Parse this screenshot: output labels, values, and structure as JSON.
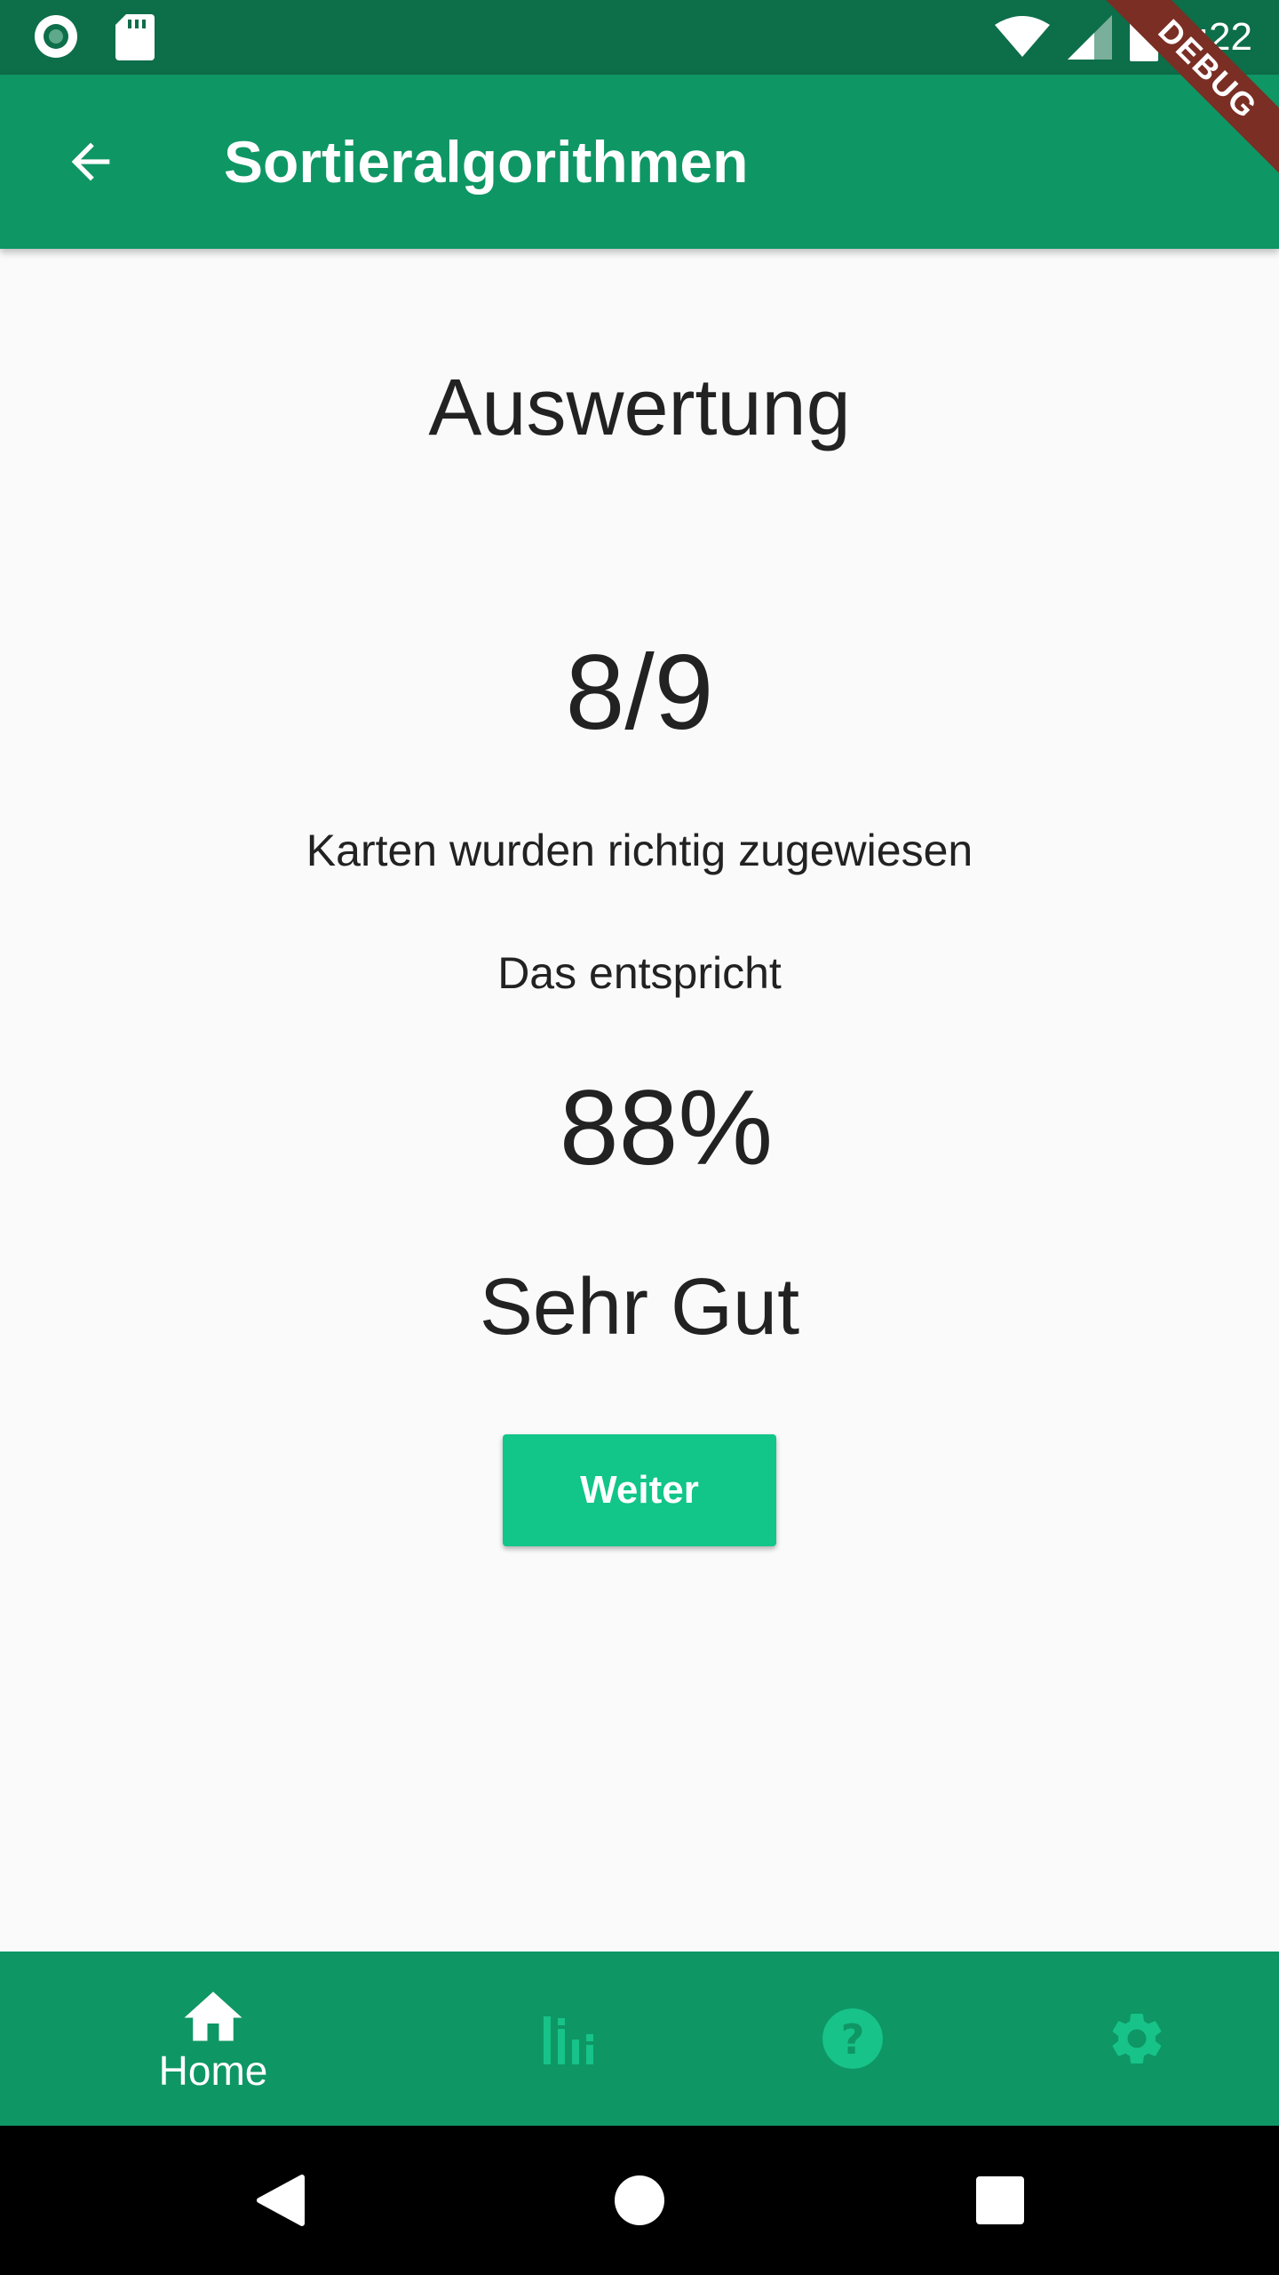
{
  "status_bar": {
    "time": "4:22",
    "icons": [
      "record-icon",
      "sd-card-icon",
      "wifi-icon",
      "signal-icon",
      "battery-icon"
    ]
  },
  "debug_banner": "DEBUG",
  "app_bar": {
    "title": "Sortieralgorithmen",
    "back_icon": "arrow-back-icon"
  },
  "result": {
    "heading": "Auswertung",
    "score": "8/9",
    "score_caption": "Karten wurden richtig zugewiesen",
    "equals_caption": "Das entspricht",
    "percent": "88%",
    "grade": "Sehr Gut",
    "next_button": "Weiter"
  },
  "bottom_nav": {
    "items": [
      {
        "label": "Home",
        "icon": "home-icon",
        "active": true
      },
      {
        "label": "",
        "icon": "bar-chart-icon",
        "active": false
      },
      {
        "label": "",
        "icon": "help-icon",
        "active": false
      },
      {
        "label": "",
        "icon": "settings-icon",
        "active": false
      }
    ]
  },
  "colors": {
    "status_bar": "#0d6e4a",
    "primary": "#0f9665",
    "button": "#12c589",
    "inactive_icon": "#17c389",
    "text": "#222222",
    "background": "#fafafa"
  }
}
